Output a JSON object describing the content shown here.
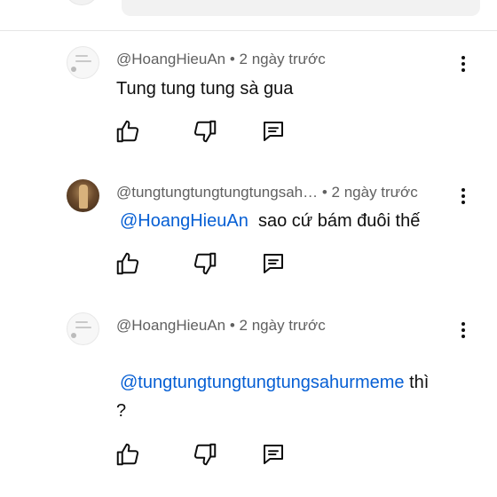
{
  "comments": [
    {
      "author": "@HoangHieuAn",
      "separator": "•",
      "time": "2 ngày trước",
      "avatar": "light-avatar",
      "text_parts": [
        "Tung tung tung sà gua"
      ]
    },
    {
      "author": "@tungtungtungtungtungsah…",
      "separator": "•",
      "time": "2 ngày trước",
      "avatar": "dark-avatar",
      "mention": "@HoangHieuAn",
      "text_parts": [
        "sao cứ bám đuôi thế"
      ]
    },
    {
      "author": "@HoangHieuAn",
      "separator": "•",
      "time": "2 ngày trước",
      "avatar": "light-avatar",
      "mention": "@tungtungtungtungtungsahurmeme",
      "text_parts": [
        "thì",
        "?"
      ]
    }
  ],
  "icons": {
    "like": "thumbs-up-icon",
    "dislike": "thumbs-down-icon",
    "reply": "reply-icon",
    "menu": "more-vert-icon"
  },
  "colors": {
    "mention": "#065fd4",
    "meta": "#606060",
    "text": "#0f0f0f"
  }
}
